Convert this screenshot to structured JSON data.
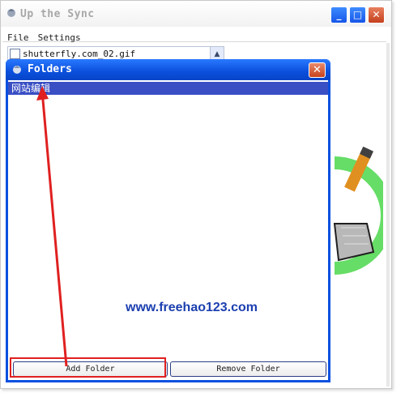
{
  "window": {
    "title": "Up the Sync",
    "minimize_glyph": "_",
    "maximize_glyph": "□",
    "close_glyph": "✕"
  },
  "menu": {
    "items": [
      "File",
      "Settings"
    ]
  },
  "file_list": {
    "first_item": "shutterfly.com_02.gif",
    "scroll_glyph": "▲"
  },
  "dialog": {
    "title": "Folders",
    "close_glyph": "✕",
    "folders": [
      "网站编辑"
    ],
    "add_label": "Add Folder",
    "remove_label": "Remove Folder"
  },
  "watermark": "www.freehao123.com",
  "colors": {
    "dialog_frame": "#0a50e0",
    "selection": "#3a4fc4",
    "annotation": "#e02020",
    "watermark": "#1b3fb0"
  }
}
